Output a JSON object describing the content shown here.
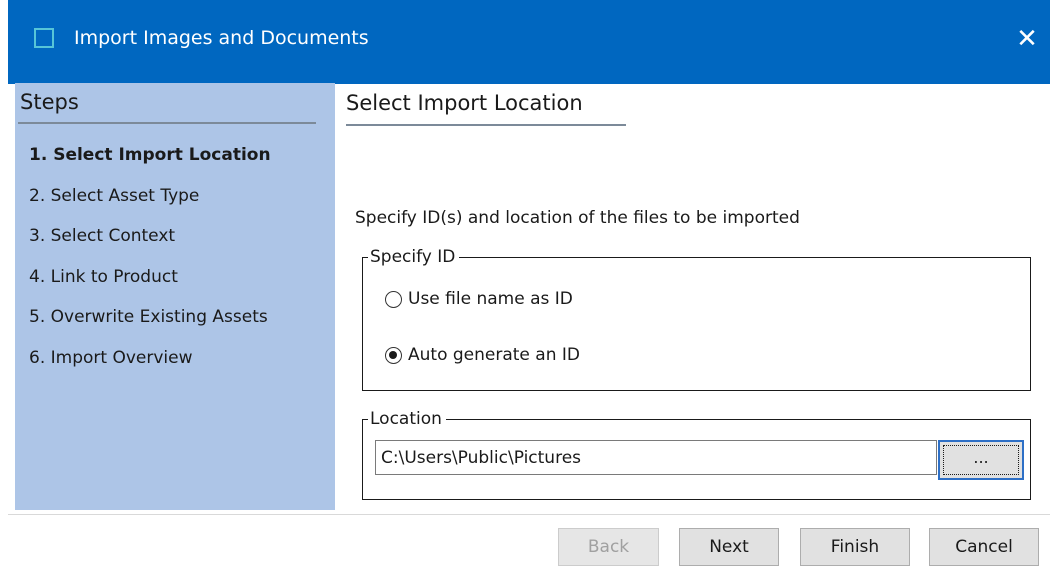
{
  "window": {
    "title": "Import Images and Documents",
    "close_glyph": "✕"
  },
  "sidebar": {
    "heading": "Steps",
    "steps": [
      {
        "label": "1. Select Import Location",
        "active": true
      },
      {
        "label": "2. Select Asset Type",
        "active": false
      },
      {
        "label": "3. Select Context",
        "active": false
      },
      {
        "label": "4. Link to Product",
        "active": false
      },
      {
        "label": "5. Overwrite Existing Assets",
        "active": false
      },
      {
        "label": "6. Import Overview",
        "active": false
      }
    ]
  },
  "main": {
    "title": "Select Import Location",
    "instruction": "Specify ID(s) and location of the files to be imported",
    "specify_id": {
      "legend": "Specify ID",
      "options": [
        {
          "label": "Use file name as ID",
          "checked": false
        },
        {
          "label": "Auto generate an ID",
          "checked": true
        }
      ]
    },
    "location": {
      "legend": "Location",
      "value": "C:\\Users\\Public\\Pictures",
      "browse_label": "..."
    }
  },
  "footer": {
    "back_label": "Back",
    "next_label": "Next",
    "finish_label": "Finish",
    "cancel_label": "Cancel",
    "back_enabled": false
  },
  "colors": {
    "titlebar": "#0067c0",
    "sidebar": "#adc5e7",
    "focus_border": "#2d6fc6"
  }
}
